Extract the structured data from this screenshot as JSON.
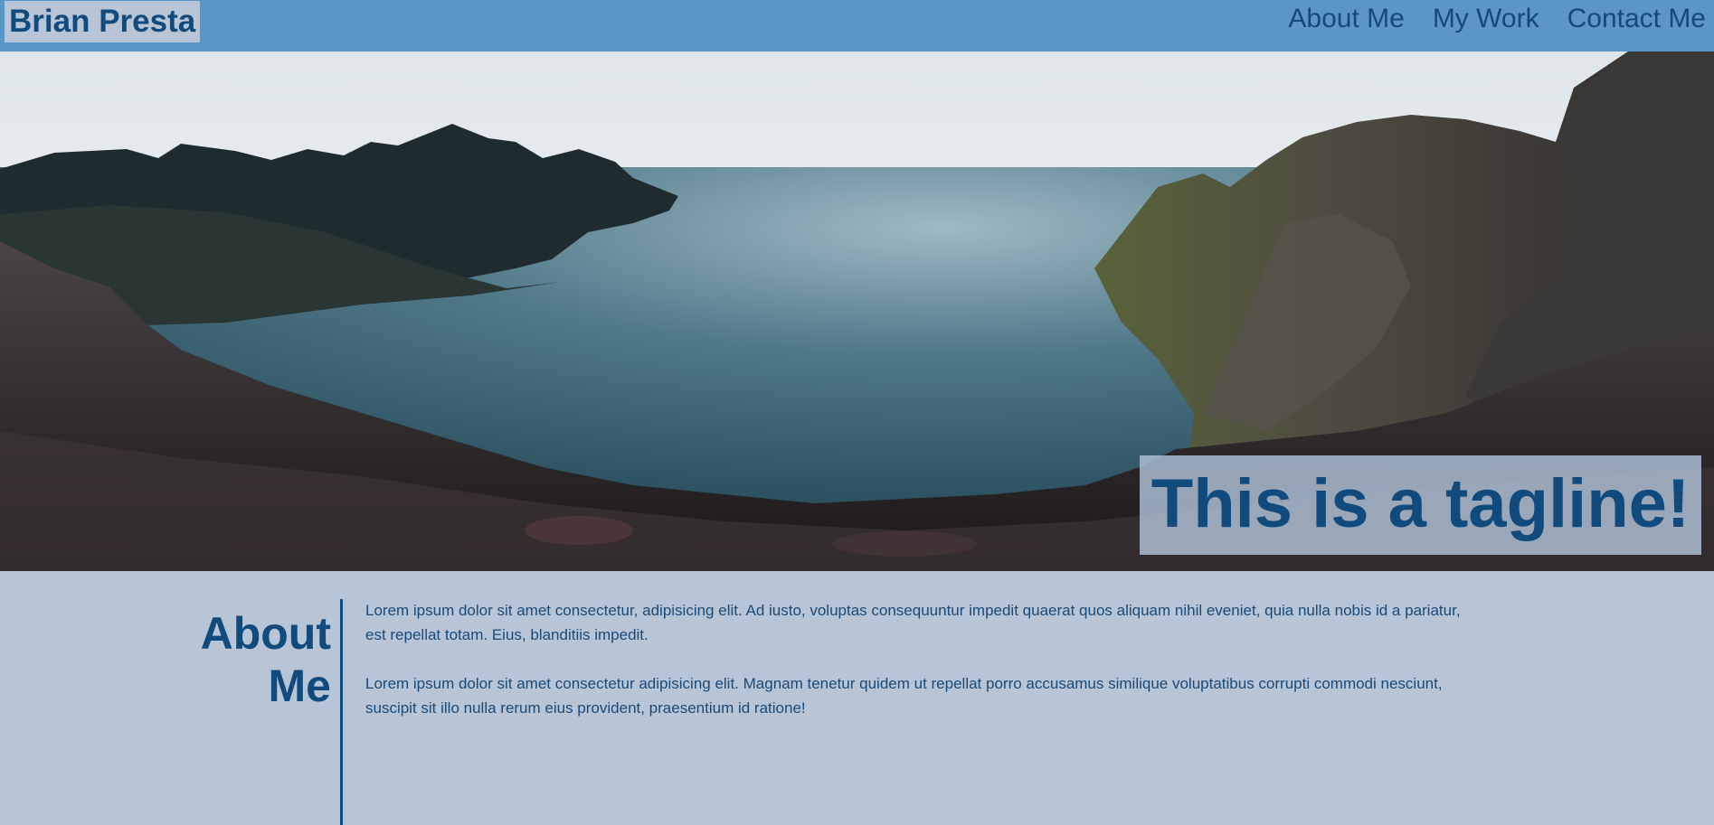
{
  "header": {
    "brand": "Brian Presta",
    "nav": [
      "About Me",
      "My Work",
      "Contact Me"
    ]
  },
  "hero": {
    "image_description": "fjord-landscape-photo",
    "tagline": "This is a tagline!"
  },
  "about": {
    "title": "About Me",
    "paragraphs": [
      "Lorem ipsum dolor sit amet consectetur, adipisicing elit. Ad iusto, voluptas consequuntur impedit quaerat quos aliquam nihil eveniet, quia nulla nobis id a pariatur, est repellat totam. Eius, blanditiis impedit.",
      "Lorem ipsum dolor sit amet consectetur adipisicing elit. Magnam tenetur quidem ut repellat porro accusamus similique voluptatibus corrupti commodi nesciunt, suscipit sit illo nulla rerum eius provident, praesentium id ratione!"
    ]
  },
  "colors": {
    "header_bg": "#5a96c8",
    "page_bg": "#b7c5d7",
    "brand_text": "#114b7d"
  }
}
